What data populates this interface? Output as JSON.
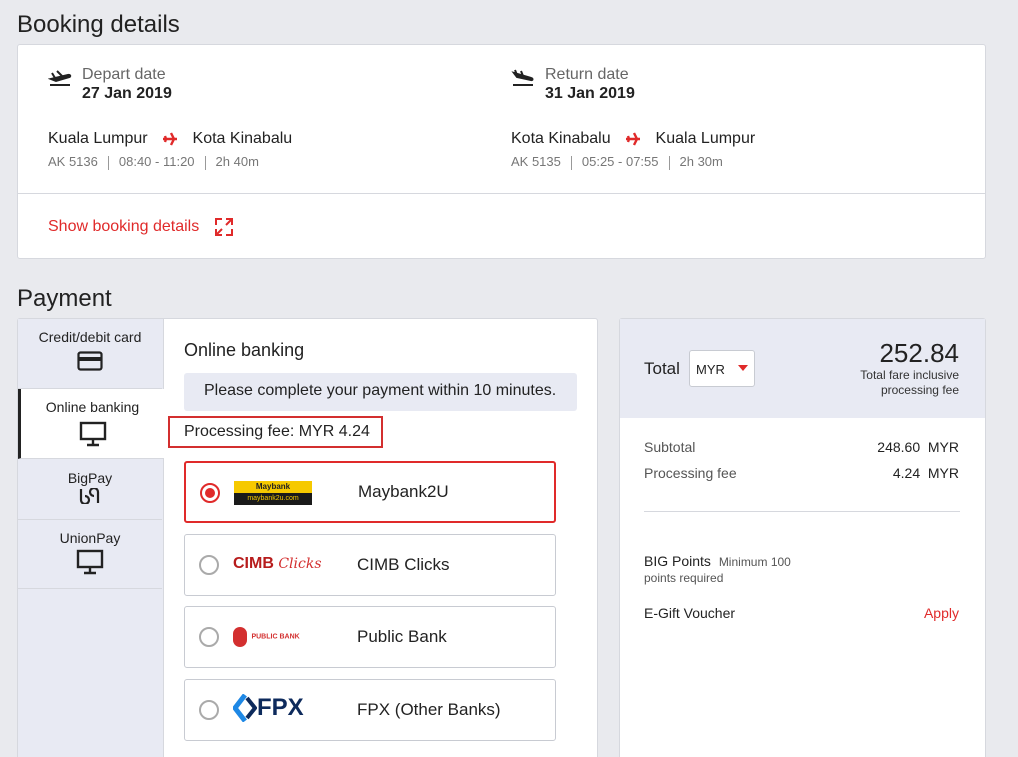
{
  "booking": {
    "title": "Booking details",
    "depart": {
      "label": "Depart date",
      "date": "27 Jan 2019",
      "from": "Kuala Lumpur",
      "to": "Kota Kinabalu",
      "flight": "AK 5136",
      "time": "08:40 - 11:20",
      "duration": "2h 40m"
    },
    "return": {
      "label": "Return date",
      "date": "31 Jan 2019",
      "from": "Kota Kinabalu",
      "to": "Kuala Lumpur",
      "flight": "AK 5135",
      "time": "05:25 - 07:55",
      "duration": "2h 30m"
    },
    "show_details": "Show booking details"
  },
  "payment": {
    "title": "Payment",
    "tabs": [
      {
        "label": "Credit/debit card",
        "icon": "card-icon"
      },
      {
        "label": "Online banking",
        "icon": "monitor-icon",
        "active": true
      },
      {
        "label": "BigPay",
        "icon": "bigpay-icon"
      },
      {
        "label": "UnionPay",
        "icon": "monitor-icon"
      }
    ],
    "section_title": "Online banking",
    "notice": "Please complete your payment within 10 minutes.",
    "processing_fee": "Processing fee: MYR 4.24",
    "banks": [
      {
        "name": "Maybank2U",
        "logo": "Maybank",
        "logo_sub": "maybank2u.com",
        "selected": true
      },
      {
        "name": "CIMB Clicks",
        "logo": "CIMB Clicks",
        "selected": false
      },
      {
        "name": "Public Bank",
        "logo": "PUBLIC BANK",
        "selected": false
      },
      {
        "name": "FPX (Other Banks)",
        "logo": "FPX",
        "selected": false
      }
    ]
  },
  "summary": {
    "total_label": "Total",
    "currency": "MYR",
    "total": "252.84",
    "total_note_1": "Total fare inclusive",
    "total_note_2": "processing fee",
    "subtotal_label": "Subtotal",
    "subtotal_value": "248.60  MYR",
    "fee_label": "Processing fee",
    "fee_value": "4.24  MYR",
    "big_points_label": "BIG Points",
    "big_points_note_1": "Minimum 100",
    "big_points_note_2": "points required",
    "voucher_label": "E-Gift Voucher",
    "apply": "Apply"
  },
  "colors": {
    "accent": "#e02a2a",
    "highlight_box": "#d32f2f",
    "summary_header": "#e8eaf3"
  }
}
